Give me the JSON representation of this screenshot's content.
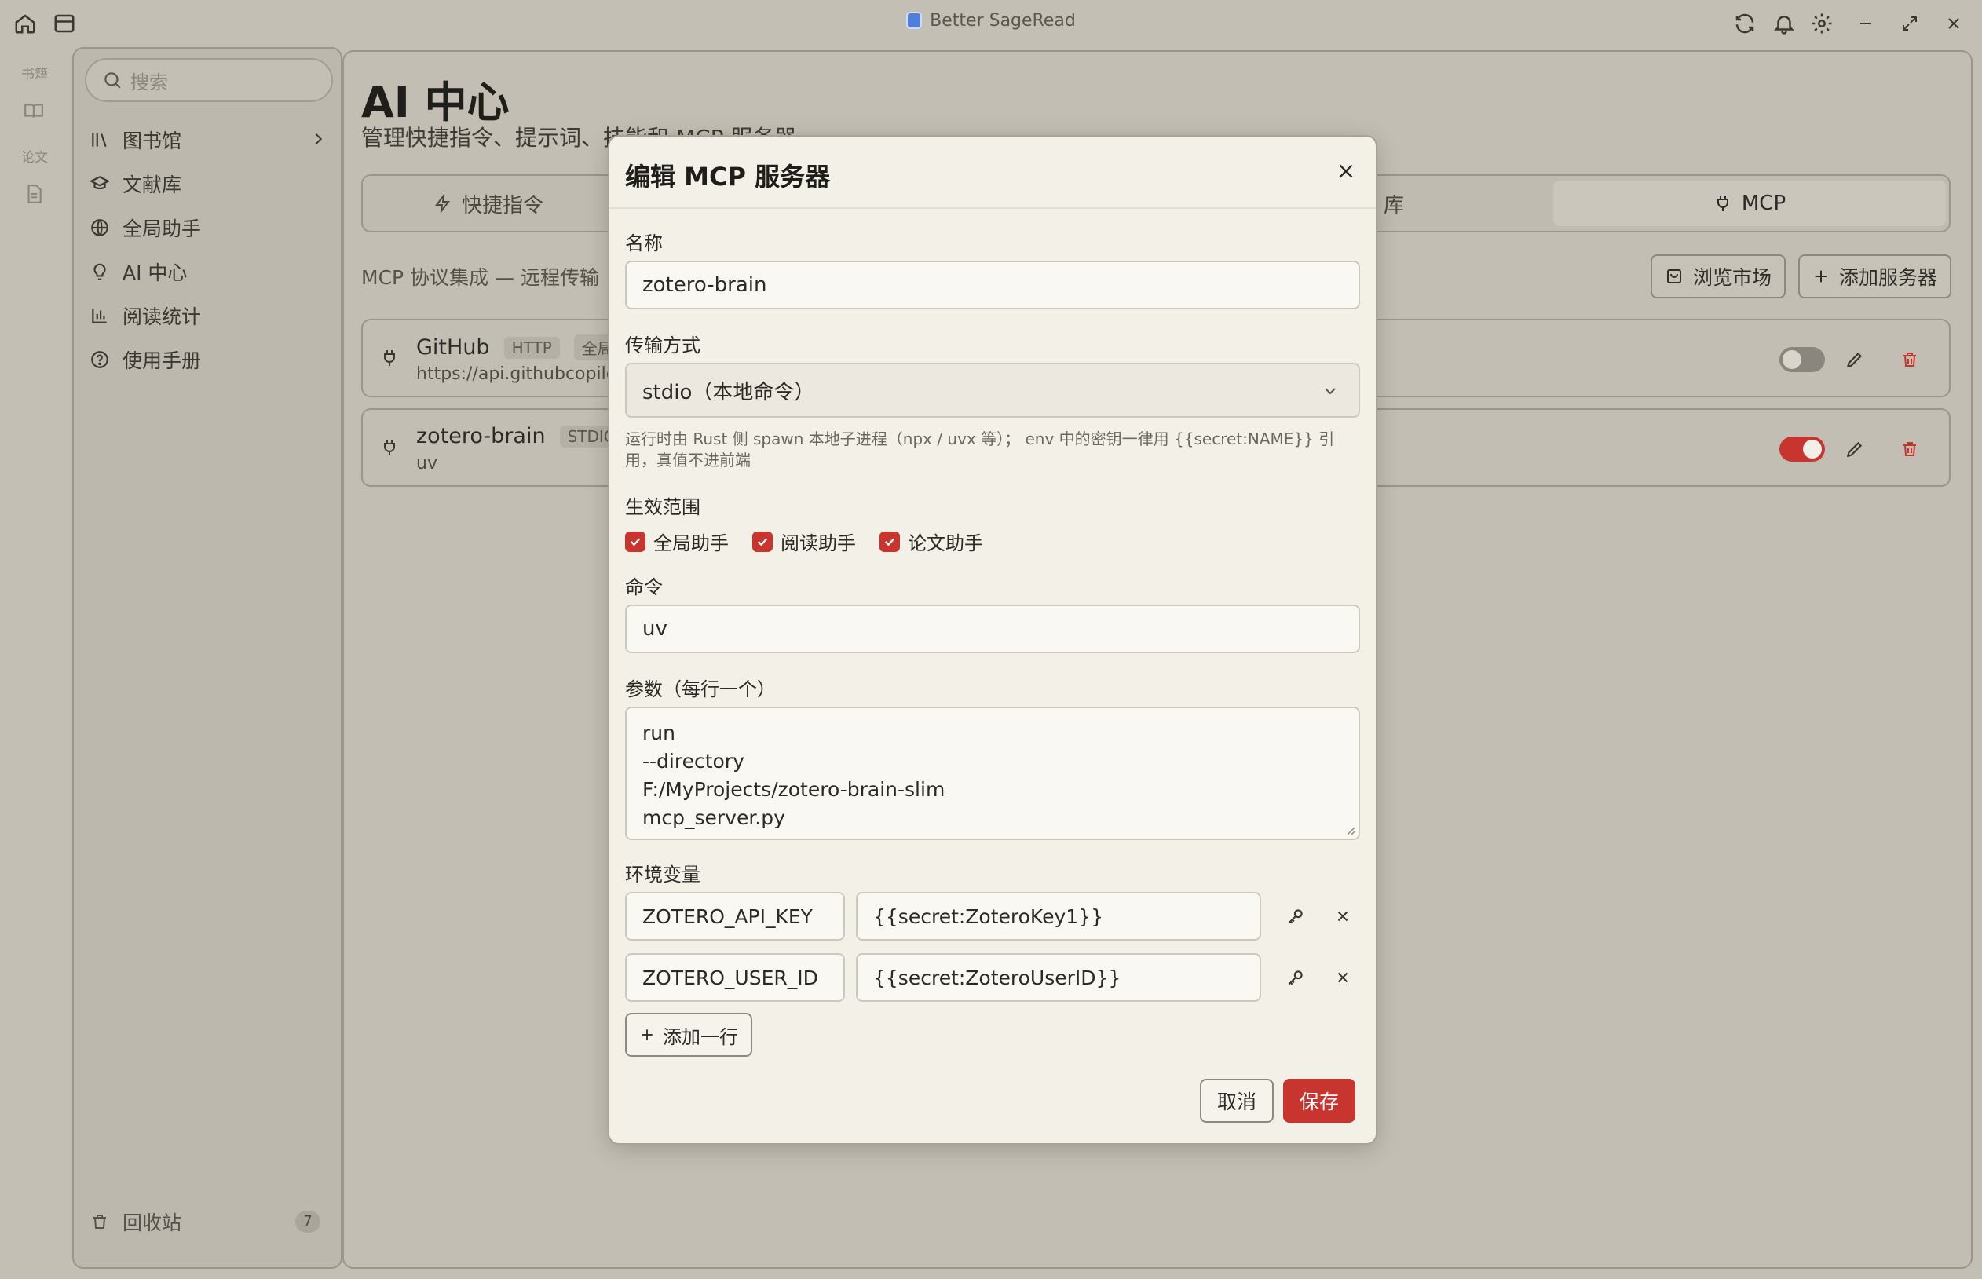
{
  "window": {
    "title": "Better SageRead"
  },
  "rail": {
    "books_label": "书籍",
    "papers_label": "论文"
  },
  "sidebar": {
    "search_placeholder": "搜索",
    "items": [
      {
        "label": "图书馆",
        "icon": "library-icon"
      },
      {
        "label": "文献库",
        "icon": "graduation-cap-icon"
      },
      {
        "label": "全局助手",
        "icon": "globe-icon"
      },
      {
        "label": "AI 中心",
        "icon": "lightbulb-icon"
      },
      {
        "label": "阅读统计",
        "icon": "bar-chart-icon"
      },
      {
        "label": "使用手册",
        "icon": "help-circle-icon"
      }
    ],
    "trash_label": "回收站",
    "trash_count": "7"
  },
  "main": {
    "title": "AI 中心",
    "subtitle": "管理快捷指令、提示词、技能和 MCP 服务器",
    "tabs": [
      {
        "label": "快捷指令",
        "active": false
      },
      {
        "label": "库",
        "active": false
      },
      {
        "label": "MCP",
        "active": true
      }
    ],
    "section_label": "MCP 协议集成 — 远程传输",
    "browse_market_label": "浏览市场",
    "add_server_label": "添加服务器",
    "servers": [
      {
        "name": "GitHub",
        "transport": "HTTP",
        "scope": "全局",
        "url": "https://api.githubcopilot",
        "enabled": false
      },
      {
        "name": "zotero-brain",
        "transport": "STDIO",
        "url": "uv",
        "enabled": true
      }
    ]
  },
  "modal": {
    "title": "编辑 MCP 服务器",
    "name_label": "名称",
    "name_value": "zotero-brain",
    "transport_label": "传输方式",
    "transport_value": "stdio（本地命令）",
    "transport_hint": "运行时由 Rust 侧 spawn 本地子进程（npx / uvx 等）； env 中的密钥一律用 {{secret:NAME}} 引用，真值不进前端",
    "scope_label": "生效范围",
    "scopes": [
      {
        "label": "全局助手",
        "checked": true
      },
      {
        "label": "阅读助手",
        "checked": true
      },
      {
        "label": "论文助手",
        "checked": true
      }
    ],
    "command_label": "命令",
    "command_value": "uv",
    "args_label": "参数（每行一个）",
    "args": [
      "run",
      "--directory",
      "F:/MyProjects/zotero-brain-slim",
      "mcp_server.py"
    ],
    "env_label": "环境变量",
    "env": [
      {
        "key": "ZOTERO_API_KEY",
        "value": "{{secret:ZoteroKey1}}"
      },
      {
        "key": "ZOTERO_USER_ID",
        "value": "{{secret:ZoteroUserID}}"
      }
    ],
    "add_row_label": "添加一行",
    "cancel_label": "取消",
    "save_label": "保存"
  },
  "colors": {
    "accent": "#c8352e",
    "toggle_off": "#8a867e"
  }
}
